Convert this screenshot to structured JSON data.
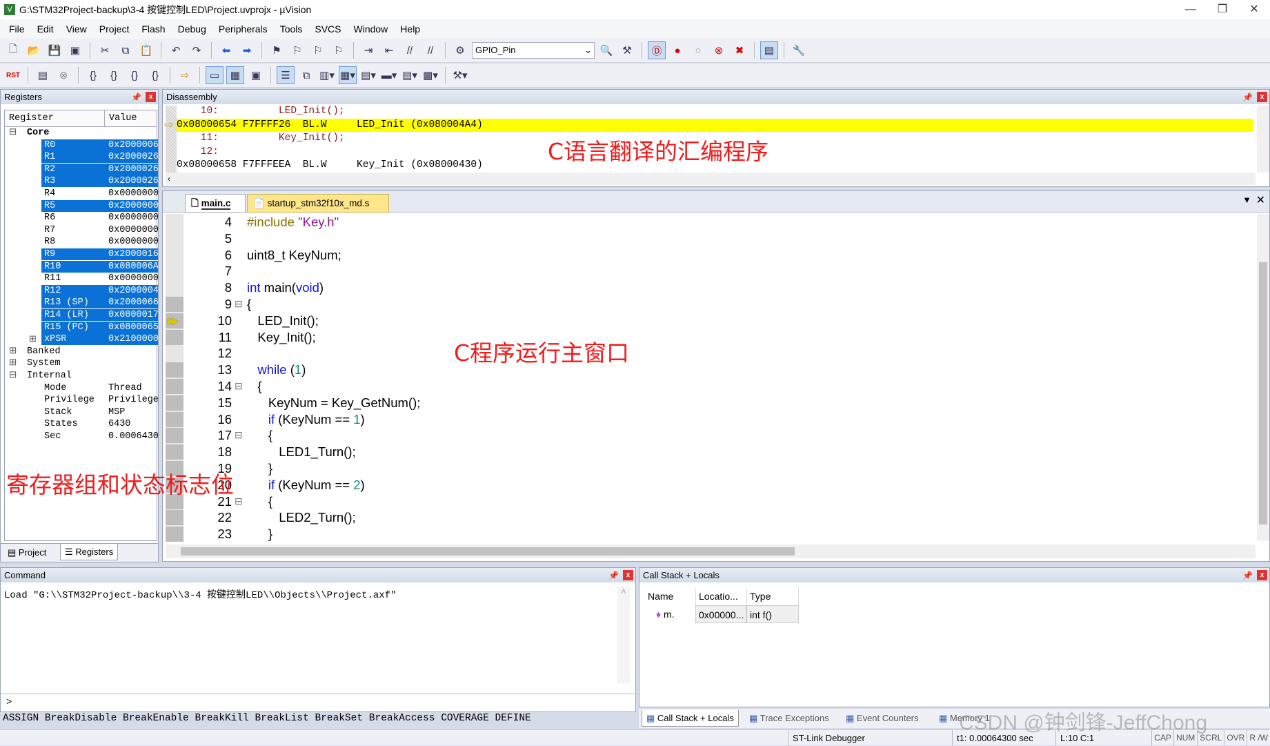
{
  "window": {
    "title": "G:\\STM32Project-backup\\3-4 按键控制LED\\Project.uvprojx - µVision",
    "minimize": "—",
    "restore": "❐",
    "close": "✕"
  },
  "menu": [
    "File",
    "Edit",
    "View",
    "Project",
    "Flash",
    "Debug",
    "Peripherals",
    "Tools",
    "SVCS",
    "Window",
    "Help"
  ],
  "toolbar": {
    "target_select": "GPIO_Pin"
  },
  "registers": {
    "title": "Registers",
    "col_register": "Register",
    "col_value": "Value",
    "groups": {
      "core": "Core",
      "banked": "Banked",
      "system": "System",
      "internal": "Internal"
    },
    "core": [
      {
        "name": "R0",
        "value": "0x2000006",
        "sel": true
      },
      {
        "name": "R1",
        "value": "0x2000026",
        "sel": true
      },
      {
        "name": "R2",
        "value": "0x2000026",
        "sel": true
      },
      {
        "name": "R3",
        "value": "0x2000026",
        "sel": true
      },
      {
        "name": "R4",
        "value": "0x0000000",
        "sel": false
      },
      {
        "name": "R5",
        "value": "0x2000000",
        "sel": true
      },
      {
        "name": "R6",
        "value": "0x0000000",
        "sel": false
      },
      {
        "name": "R7",
        "value": "0x0000000",
        "sel": false
      },
      {
        "name": "R8",
        "value": "0x0000000",
        "sel": false
      },
      {
        "name": "R9",
        "value": "0x2000016",
        "sel": true
      },
      {
        "name": "R10",
        "value": "0x080006A",
        "sel": true
      },
      {
        "name": "R11",
        "value": "0x0000000",
        "sel": false
      },
      {
        "name": "R12",
        "value": "0x2000004",
        "sel": true
      },
      {
        "name": "R13 (SP)",
        "value": "0x2000066",
        "sel": true
      },
      {
        "name": "R14 (LR)",
        "value": "0x0800017",
        "sel": true
      },
      {
        "name": "R15 (PC)",
        "value": "0x0800065",
        "sel": true
      },
      {
        "name": "xPSR",
        "value": "0x2100000",
        "sel": true
      }
    ],
    "internal": [
      {
        "name": "Mode",
        "value": "Thread"
      },
      {
        "name": "Privilege",
        "value": "Privilege"
      },
      {
        "name": "Stack",
        "value": "MSP"
      },
      {
        "name": "States",
        "value": "6430"
      },
      {
        "name": "Sec",
        "value": "0.0006430"
      }
    ],
    "tabs": {
      "project": "Project",
      "registers": "Registers"
    }
  },
  "disassembly": {
    "title": "Disassembly",
    "lines": [
      {
        "text": "    10:          LED_Init();",
        "type": "src"
      },
      {
        "text": "0x08000654 F7FFFF26  BL.W     LED_Init (0x080004A4)",
        "type": "cur"
      },
      {
        "text": "    11:          Key_Init();",
        "type": "src"
      },
      {
        "text": "    12:",
        "type": "src"
      },
      {
        "text": "0x08000658 F7FFFEEA  BL.W     Key_Init (0x08000430)",
        "type": "asm"
      }
    ]
  },
  "editor": {
    "tabs": [
      "main.c",
      "startup_stm32f10x_md.s"
    ],
    "lines": [
      {
        "n": "4",
        "s": [
          [
            "pp",
            "#include "
          ],
          [
            "str",
            "\"Key.h\""
          ]
        ]
      },
      {
        "n": "5",
        "s": []
      },
      {
        "n": "6",
        "s": [
          [
            "",
            "uint8_t KeyNum;"
          ]
        ]
      },
      {
        "n": "7",
        "s": []
      },
      {
        "n": "8",
        "s": [
          [
            "kw",
            "int"
          ],
          [
            "",
            " main("
          ],
          [
            "kw",
            "void"
          ],
          [
            "",
            ")"
          ]
        ]
      },
      {
        "n": "9",
        "s": [
          [
            "",
            "{"
          ]
        ],
        "fold": true
      },
      {
        "n": "10",
        "s": [
          [
            "",
            "   LED_Init();"
          ]
        ],
        "cur": true
      },
      {
        "n": "11",
        "s": [
          [
            "",
            "   Key_Init();"
          ]
        ]
      },
      {
        "n": "12",
        "s": []
      },
      {
        "n": "13",
        "s": [
          [
            "",
            "   "
          ],
          [
            "kw",
            "while"
          ],
          [
            "",
            " ("
          ],
          [
            "num",
            "1"
          ],
          [
            "",
            ")"
          ]
        ]
      },
      {
        "n": "14",
        "s": [
          [
            "",
            "   {"
          ]
        ],
        "fold": true
      },
      {
        "n": "15",
        "s": [
          [
            "",
            "      KeyNum = Key_GetNum();"
          ]
        ]
      },
      {
        "n": "16",
        "s": [
          [
            "",
            "      "
          ],
          [
            "kw",
            "if"
          ],
          [
            "",
            " (KeyNum == "
          ],
          [
            "num",
            "1"
          ],
          [
            "",
            ")"
          ]
        ]
      },
      {
        "n": "17",
        "s": [
          [
            "",
            "      {"
          ]
        ],
        "fold": true
      },
      {
        "n": "18",
        "s": [
          [
            "",
            "         LED1_Turn();"
          ]
        ]
      },
      {
        "n": "19",
        "s": [
          [
            "",
            "      }"
          ]
        ]
      },
      {
        "n": "20",
        "s": [
          [
            "",
            "      "
          ],
          [
            "kw",
            "if"
          ],
          [
            "",
            " (KeyNum == "
          ],
          [
            "num",
            "2"
          ],
          [
            "",
            ")"
          ]
        ]
      },
      {
        "n": "21",
        "s": [
          [
            "",
            "      {"
          ]
        ],
        "fold": true
      },
      {
        "n": "22",
        "s": [
          [
            "",
            "         LED2_Turn();"
          ]
        ]
      },
      {
        "n": "23",
        "s": [
          [
            "",
            "      }"
          ]
        ]
      }
    ]
  },
  "command": {
    "title": "Command",
    "output": "Load \"G:\\\\STM32Project-backup\\\\3-4 按键控制LED\\\\Objects\\\\Project.axf\"",
    "prompt": ">",
    "hints": "ASSIGN BreakDisable BreakEnable BreakKill BreakList BreakSet BreakAccess COVERAGE DEFINE"
  },
  "callstack": {
    "title": "Call Stack + Locals",
    "columns": [
      "Name",
      "Locatio...",
      "Type"
    ],
    "rows": [
      {
        "name": "m.",
        "location": "0x00000...",
        "type": "int f()"
      }
    ],
    "tabs": [
      "Call Stack + Locals",
      "Trace Exceptions",
      "Event Counters",
      "Memory 1"
    ]
  },
  "status": {
    "debugger": "ST-Link Debugger",
    "time": "t1: 0.00064300 sec",
    "pos": "L:10 C:1",
    "flags": [
      "CAP",
      "NUM",
      "SCRL",
      "OVR",
      "R /W"
    ]
  },
  "annotations": {
    "disasm": "C语言翻译的汇编程序",
    "editor": "C程序运行主窗口",
    "registers": "寄存器组和状态标志位"
  },
  "watermark": "CSDN @钟剑锋-JeffChong",
  "colors": {
    "selection": "#0a72d6",
    "current_line": "#ffff00",
    "annotation": "#f21a1a"
  }
}
